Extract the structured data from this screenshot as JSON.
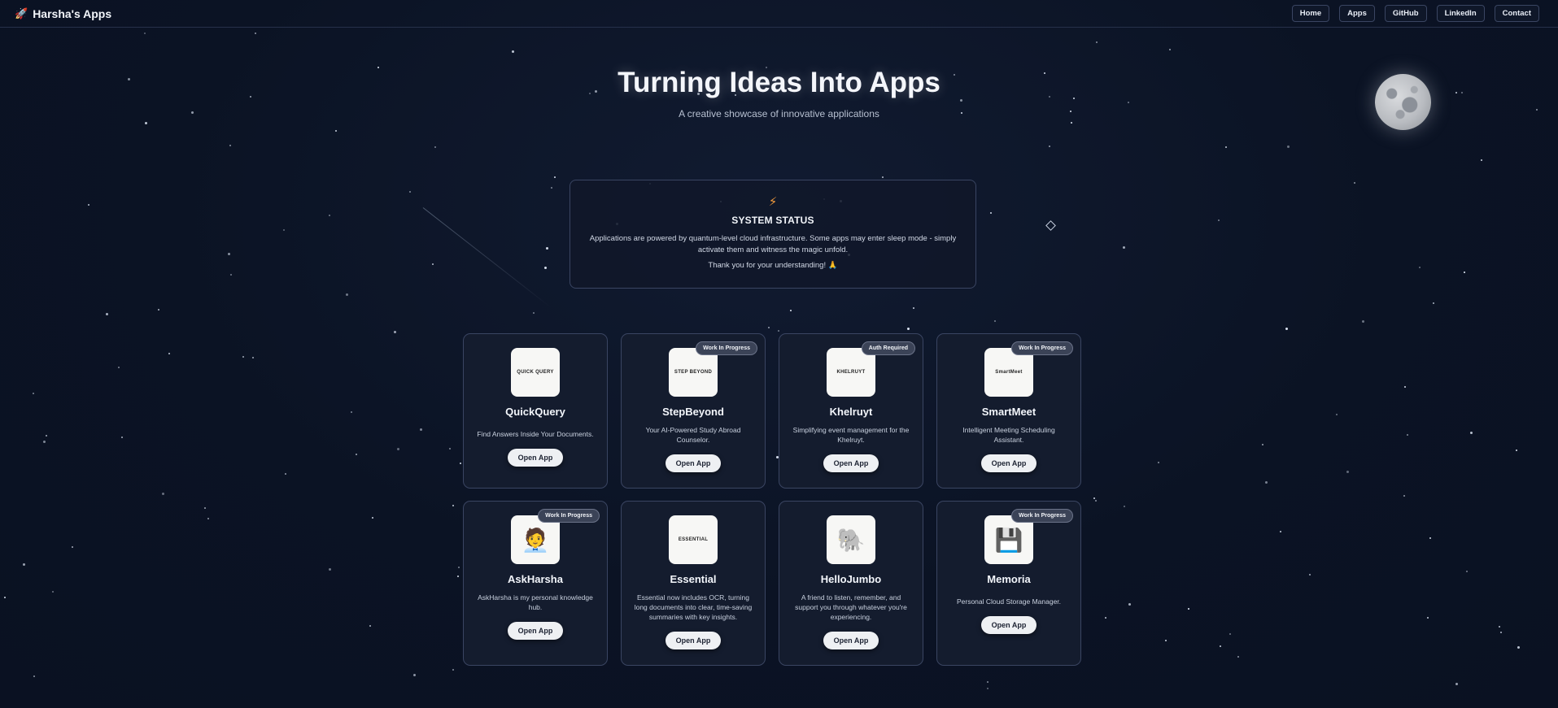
{
  "nav": {
    "brand": "Harsha's Apps",
    "links": [
      "Home",
      "Apps",
      "GitHub",
      "LinkedIn",
      "Contact"
    ]
  },
  "hero": {
    "title": "Turning Ideas Into Apps",
    "subtitle": "A creative showcase of innovative applications"
  },
  "status": {
    "title": "SYSTEM STATUS",
    "text": "Applications are powered by quantum-level cloud infrastructure. Some apps may enter sleep mode - simply activate them and witness the magic unfold.",
    "thanks": "Thank you for your understanding! 🙏"
  },
  "apps": [
    {
      "name": "QuickQuery",
      "desc": "Find Answers Inside Your Documents.",
      "badge": "",
      "logo_text": "QUICK QUERY",
      "icon": "document-search-icon"
    },
    {
      "name": "StepBeyond",
      "desc": "Your AI-Powered Study Abroad Counselor.",
      "badge": "Work In Progress",
      "logo_text": "STEP BEYOND",
      "icon": "graduation-cap-icon"
    },
    {
      "name": "Khelruyt",
      "desc": "Simplifying event management for the Khelruyt.",
      "badge": "Auth Required",
      "logo_text": "KHELRUYT",
      "icon": "event-logo-icon"
    },
    {
      "name": "SmartMeet",
      "desc": "Intelligent Meeting Scheduling Assistant.",
      "badge": "Work In Progress",
      "logo_text": "SmartMeet",
      "icon": "robot-icon"
    },
    {
      "name": "AskHarsha",
      "desc": "AskHarsha is my personal knowledge hub.",
      "badge": "Work In Progress",
      "logo_text": "",
      "icon": "person-avatar-icon"
    },
    {
      "name": "Essential",
      "desc": "Essential now includes OCR, turning long documents into clear, time-saving summaries with key insights.",
      "badge": "",
      "logo_text": "ESSENTIAL",
      "icon": "essential-logo-icon"
    },
    {
      "name": "HelloJumbo",
      "desc": "A friend to listen, remember, and support you through whatever you're experiencing.",
      "badge": "",
      "logo_text": "",
      "icon": "elephant-icon"
    },
    {
      "name": "Memoria",
      "desc": "Personal Cloud Storage Manager.",
      "badge": "Work In Progress",
      "logo_text": "",
      "icon": "sd-card-icon"
    }
  ],
  "open_label": "Open App"
}
